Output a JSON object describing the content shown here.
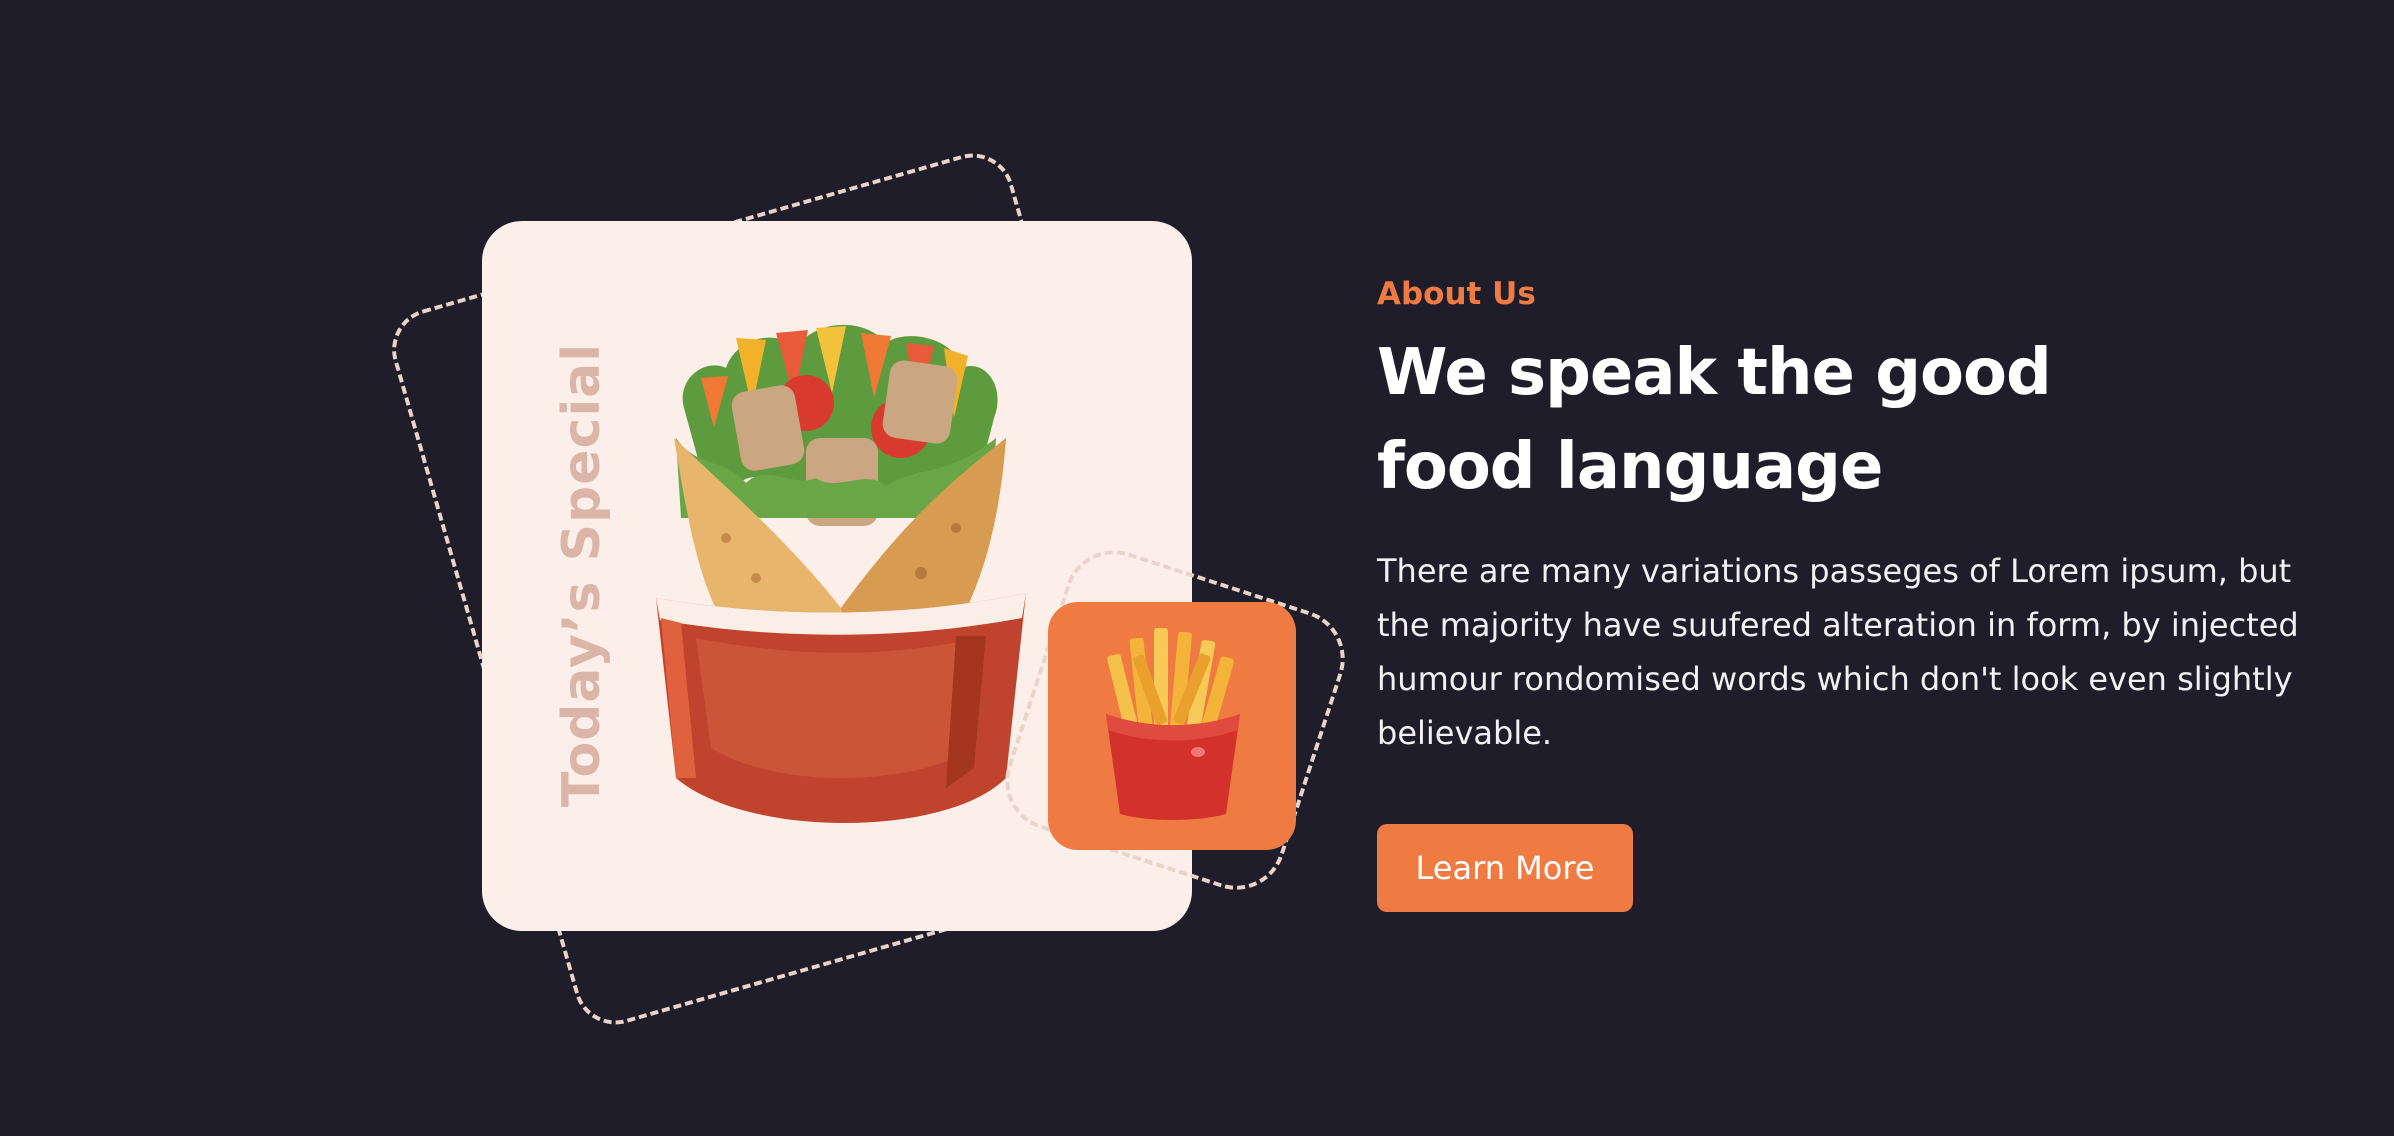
{
  "colors": {
    "background": "#1f1d2a",
    "accent": "#ef7b42",
    "card": "#fcefe9",
    "dash": "#ead3c9",
    "vertical_text": "#dbb6a8"
  },
  "visual": {
    "vertical_label": "Today’s Special",
    "main_icon": "wrap-burrito-icon",
    "badge_icon": "french-fries-icon"
  },
  "about": {
    "eyebrow": "About Us",
    "heading_line1": "We speak the good",
    "heading_line2": "food language",
    "body": "There are many variations passeges of Lorem ipsum, but the majority have suufered alteration in form, by injected humour rondomised words which don't look even slightly believable.",
    "button_label": "Learn More"
  }
}
